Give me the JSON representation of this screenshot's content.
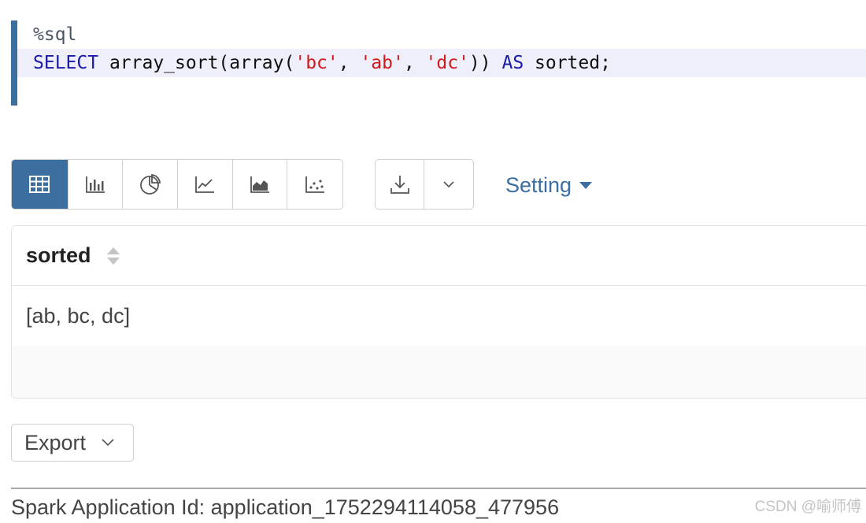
{
  "editor": {
    "interpreter": "%sql",
    "code": {
      "select": "SELECT",
      "fn_call": " array_sort(array(",
      "str1": "'bc'",
      "sep1": ", ",
      "str2": "'ab'",
      "sep2": ", ",
      "str3": "'dc'",
      "close": ")) ",
      "as": "AS",
      "alias": " sorted;"
    }
  },
  "toolbar": {
    "viz_buttons": [
      {
        "icon": "table-icon",
        "active": true
      },
      {
        "icon": "bar-chart-icon",
        "active": false
      },
      {
        "icon": "pie-chart-icon",
        "active": false
      },
      {
        "icon": "line-chart-icon",
        "active": false
      },
      {
        "icon": "area-chart-icon",
        "active": false
      },
      {
        "icon": "scatter-chart-icon",
        "active": false
      }
    ],
    "download_icon": "download-icon",
    "dropdown_icon": "chevron-down-icon",
    "setting_label": "Setting"
  },
  "table": {
    "columns": [
      "sorted"
    ],
    "rows": [
      [
        "[ab, bc, dc]"
      ]
    ]
  },
  "export_label": "Export",
  "footer": {
    "spark_app_id": "Spark Application Id: application_1752294114058_477956",
    "watermark": "CSDN @喻师傅"
  },
  "colors": {
    "accent": "#3c6e9f",
    "keyword": "#1a1aa6",
    "string": "#d11a1a",
    "active_line": "#eeeffb"
  }
}
